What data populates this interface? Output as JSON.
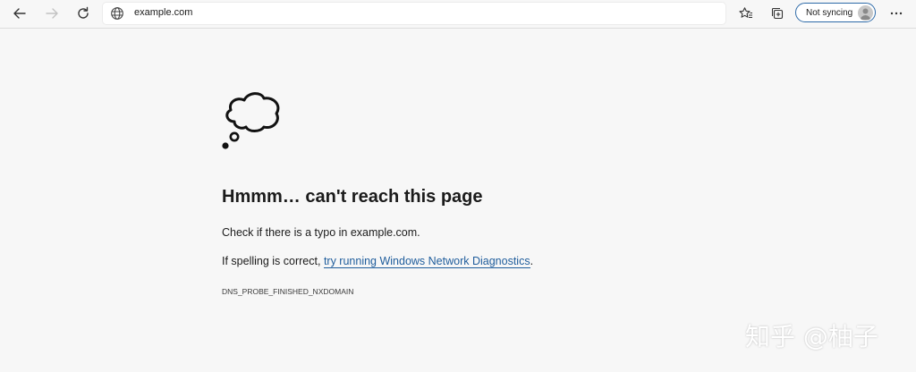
{
  "toolbar": {
    "back_icon": "back-arrow-icon",
    "forward_icon": "forward-arrow-icon",
    "refresh_icon": "refresh-icon",
    "address": {
      "site_icon": "globe-icon",
      "url": "example.com"
    },
    "favorites_icon": "favorites-star-icon",
    "collections_icon": "collections-icon",
    "sync_label": "Not syncing",
    "more_icon": "more-dots-icon"
  },
  "error": {
    "icon": "thought-cloud-icon",
    "headline": "Hmmm… can't reach this page",
    "line1": "Check if there is a typo in example.com.",
    "line2_prefix": "If spelling is correct, ",
    "line2_link": "try running Windows Network Diagnostics",
    "line2_suffix": ".",
    "code": "DNS_PROBE_FINISHED_NXDOMAIN"
  },
  "watermark": "知乎 @柚子",
  "colors": {
    "background": "#f7f7f7",
    "link": "#1f5d9c",
    "sync_border": "#2d6aa8"
  }
}
